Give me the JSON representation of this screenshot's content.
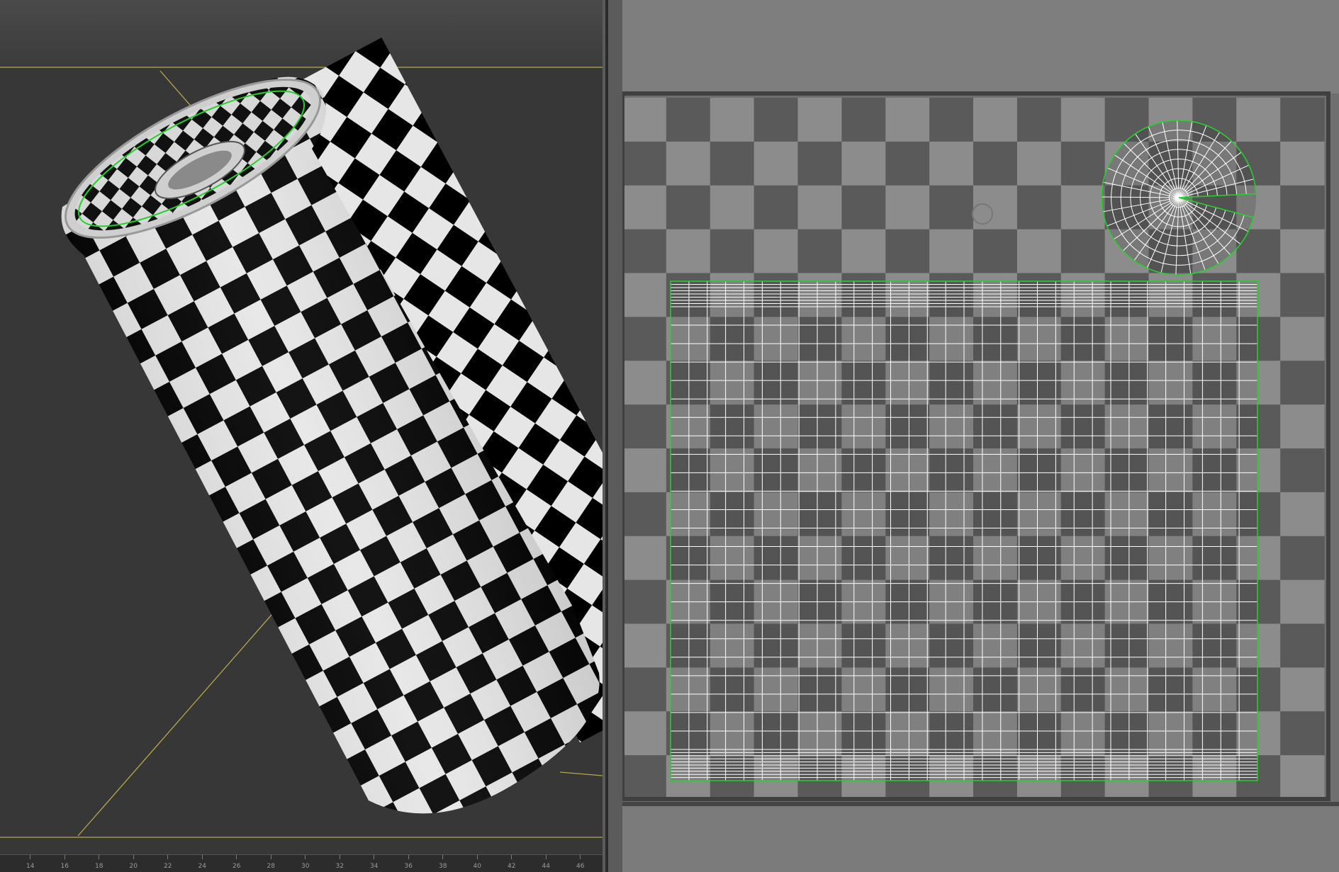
{
  "viewport": {
    "ruler_labels": [
      "14",
      "16",
      "18",
      "20",
      "22",
      "24",
      "26",
      "28",
      "30",
      "32",
      "34",
      "36",
      "38",
      "40",
      "42",
      "44",
      "46"
    ]
  },
  "uv_editor": {
    "checker_columns": 16,
    "checker_rows": 16,
    "cylinder_grid_columns": 32,
    "cylinder_grid_rows": 24,
    "cap_rings": 8,
    "cap_spokes": 32
  },
  "colors": {
    "viewport_bg": "#373737",
    "grid_line": "#b7a849",
    "selection_edge": "#22d22a",
    "checker_dark": "#000000",
    "checker_light": "#e6e6e6",
    "uv_checker_dark": "#5a5a5a",
    "uv_checker_light": "#8c8c8c",
    "uv_wire": "#ffffff"
  }
}
